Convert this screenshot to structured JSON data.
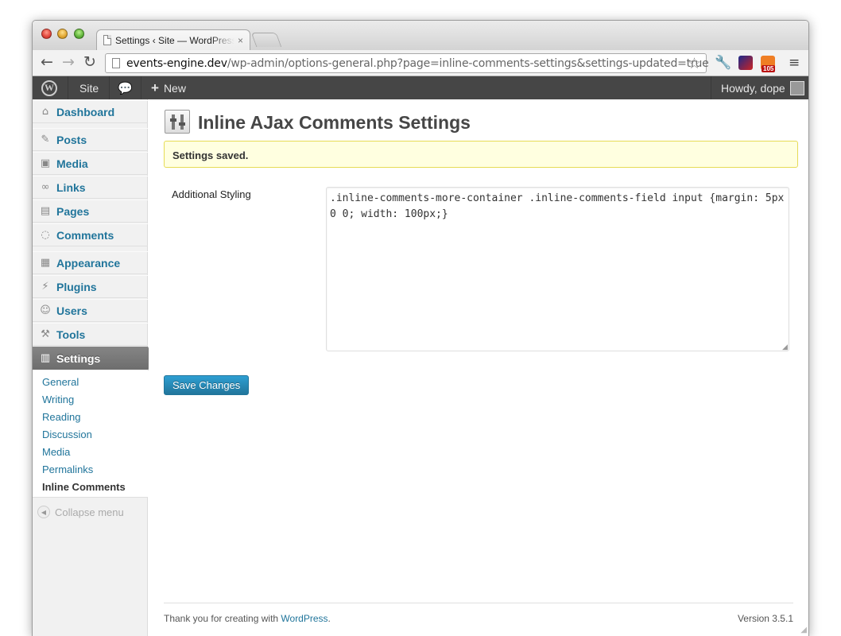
{
  "browser": {
    "tab_title": "Settings ‹ Site — WordPress",
    "tab_close": "×",
    "url_host": "events-engine.dev",
    "url_path": "/wp-admin/options-general.php?page=inline-comments-settings&settings-updated=true",
    "rss_badge": "105",
    "icons": {
      "back": "arrow-left-icon",
      "forward": "arrow-right-icon",
      "reload": "reload-icon",
      "star": "star-icon",
      "wrench": "wrench-icon",
      "menu": "hamburger-icon"
    }
  },
  "adminbar": {
    "site": "Site",
    "new": "New",
    "new_prefix": "+",
    "howdy": "Howdy, dope"
  },
  "sidebar": {
    "items": [
      {
        "label": "Dashboard",
        "icon": "dashboard-icon"
      },
      {
        "label": "Posts",
        "icon": "pin-icon"
      },
      {
        "label": "Media",
        "icon": "media-icon"
      },
      {
        "label": "Links",
        "icon": "link-icon"
      },
      {
        "label": "Pages",
        "icon": "pages-icon"
      },
      {
        "label": "Comments",
        "icon": "comment-icon"
      },
      {
        "label": "Appearance",
        "icon": "appearance-icon"
      },
      {
        "label": "Plugins",
        "icon": "plugin-icon"
      },
      {
        "label": "Users",
        "icon": "users-icon"
      },
      {
        "label": "Tools",
        "icon": "tools-icon"
      },
      {
        "label": "Settings",
        "icon": "settings-icon"
      }
    ],
    "submenu": [
      "General",
      "Writing",
      "Reading",
      "Discussion",
      "Media",
      "Permalinks",
      "Inline Comments"
    ],
    "collapse": "Collapse menu"
  },
  "main": {
    "title": "Inline AJax Comments Settings",
    "notice": "Settings saved.",
    "field_label": "Additional Styling",
    "textarea_value": ".inline-comments-more-container .inline-comments-field input {margin: 5px 0 0; width: 100px;}",
    "save_label": "Save Changes"
  },
  "footer": {
    "thanks_prefix": "Thank you for creating with ",
    "wordpress_link": "WordPress",
    "thanks_suffix": ".",
    "version": "Version 3.5.1"
  },
  "colors": {
    "accent": "#21759b",
    "adminbar": "#464646",
    "notice_bg": "#ffffe0",
    "notice_border": "#e6db55"
  }
}
